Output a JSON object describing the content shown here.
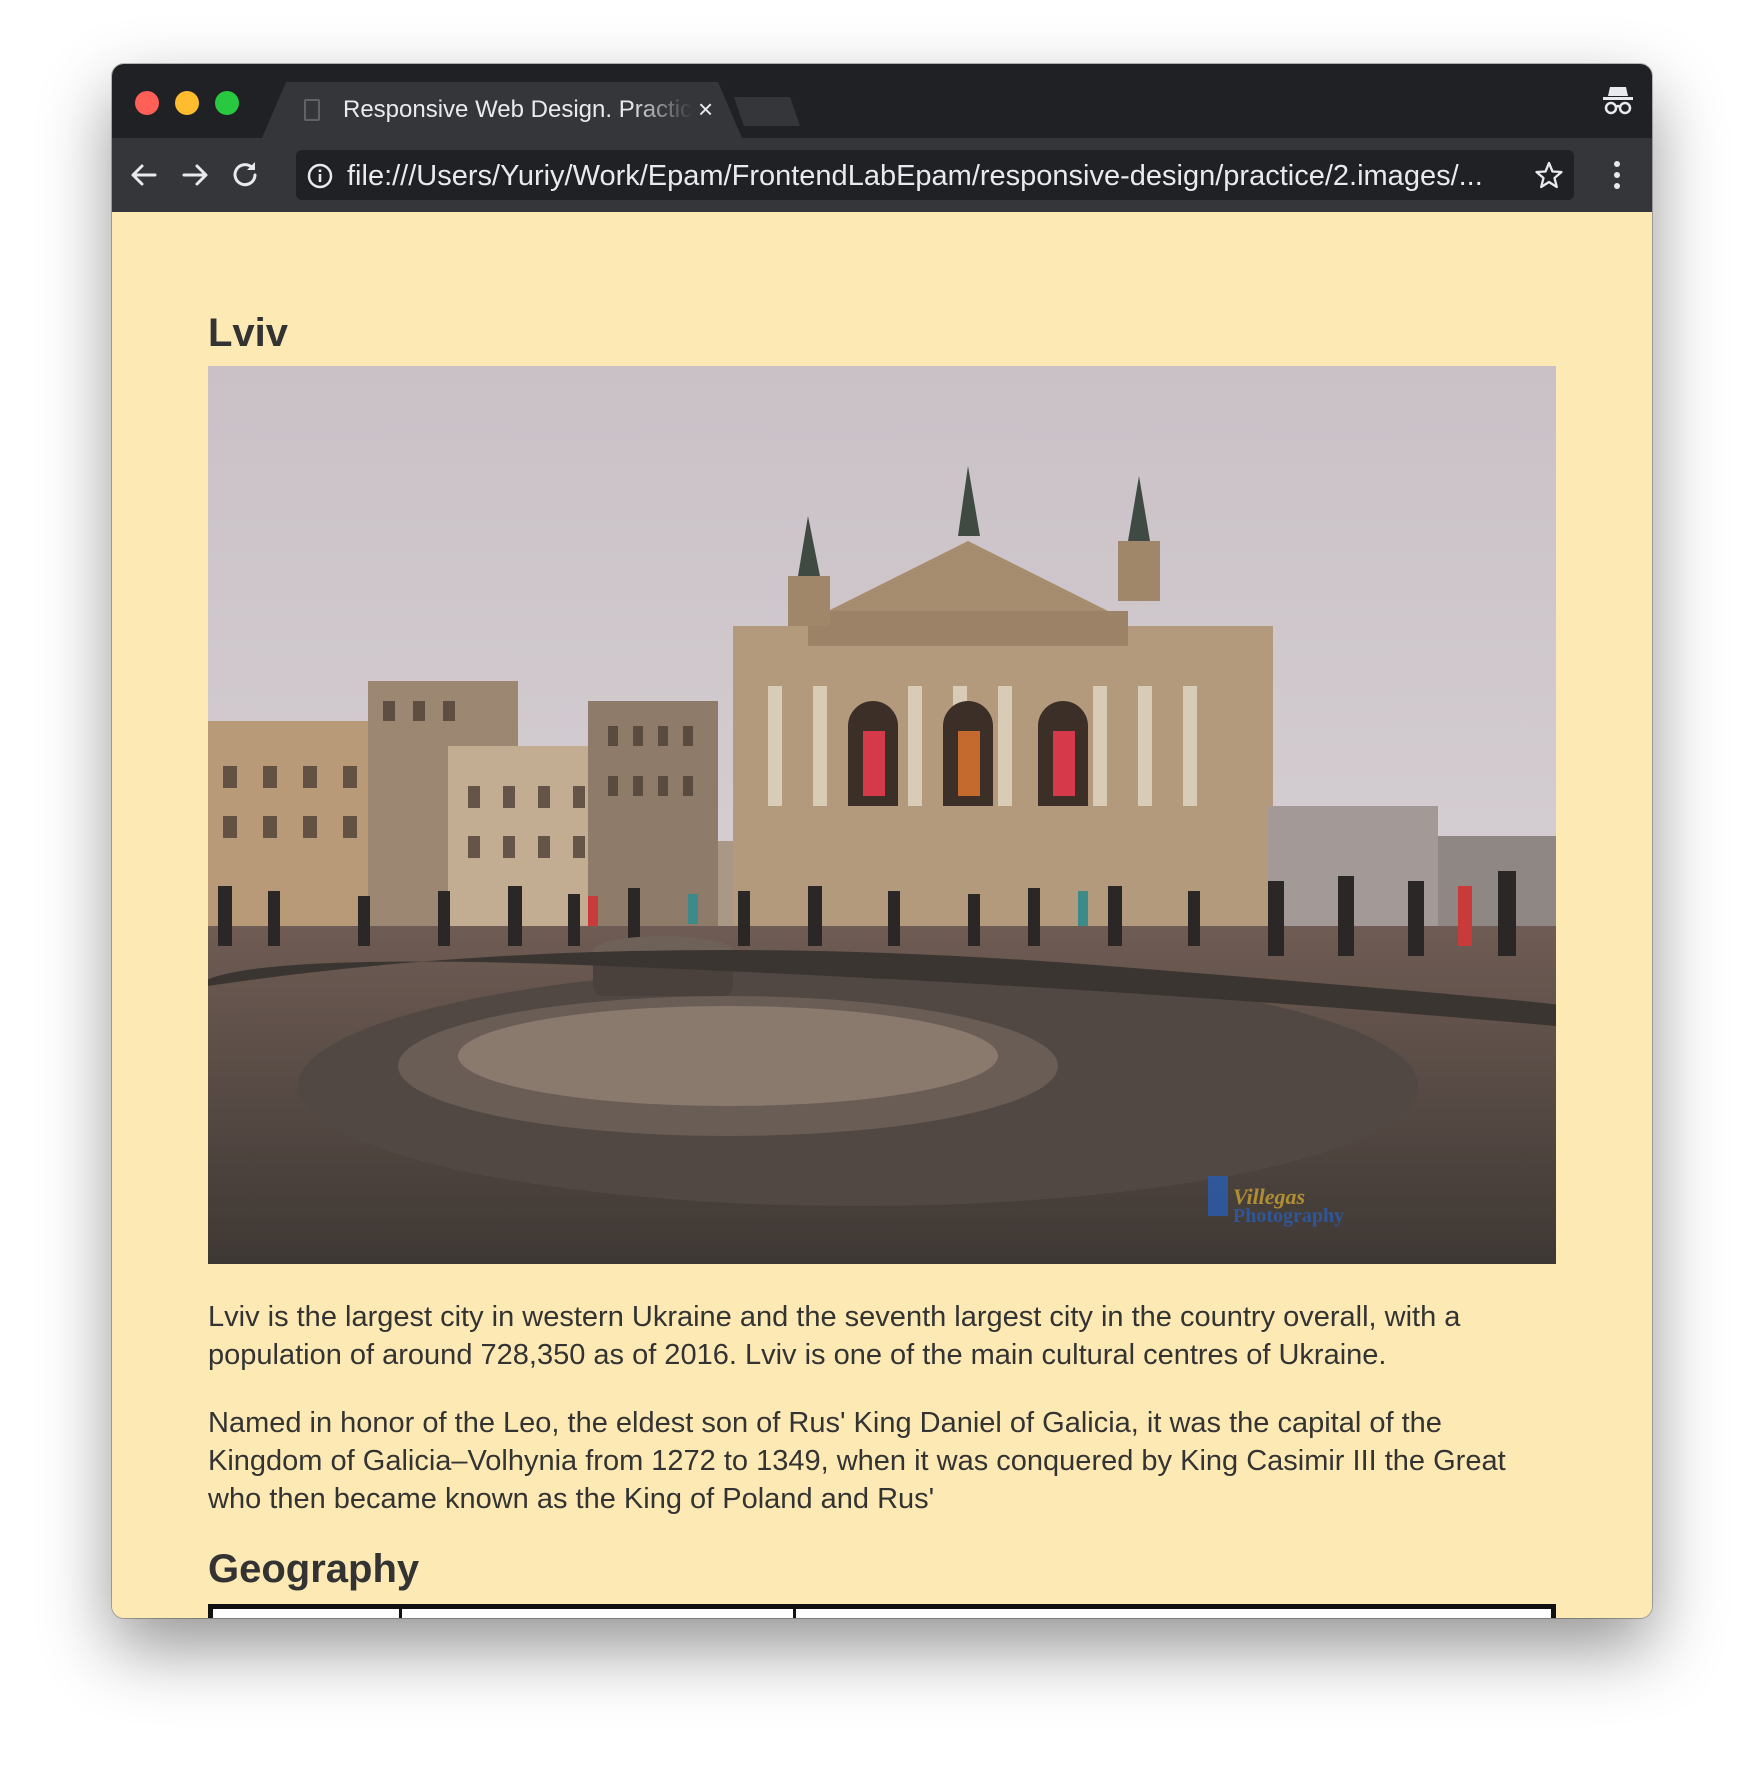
{
  "browser": {
    "tab_title": "Responsive Web Design. Practice",
    "tab_close": "×",
    "url": "file:///Users/Yuriy/Work/Epam/FrontendLabEpam/responsive-design/practice/2.images/..."
  },
  "page": {
    "heading": "Lviv",
    "image_alt": "Lviv Opera House",
    "paragraphs": [
      "Lviv is the largest city in western Ukraine and the seventh largest city in the country overall, with a population of around 728,350 as of 2016. Lviv is one of the main cultural centres of Ukraine.",
      "Named in honor of the Leo, the eldest son of Rus' King Daniel of Galicia, it was the capital of the Kingdom of Galicia–Volhynia from 1272 to 1349, when it was conquered by King Casimir III the Great who then became known as the King of Poland and Rus'"
    ],
    "section_heading": "Geography"
  },
  "colors": {
    "page_background": "#fde9b3",
    "text": "#333333",
    "titlebar": "#202124",
    "toolbar": "#35363a"
  },
  "icons": [
    "close-traffic-light",
    "minimize-traffic-light",
    "zoom-traffic-light",
    "document-icon",
    "incognito-icon",
    "back-arrow-icon",
    "forward-arrow-icon",
    "reload-icon",
    "info-icon",
    "star-icon",
    "kebab-menu-icon"
  ]
}
